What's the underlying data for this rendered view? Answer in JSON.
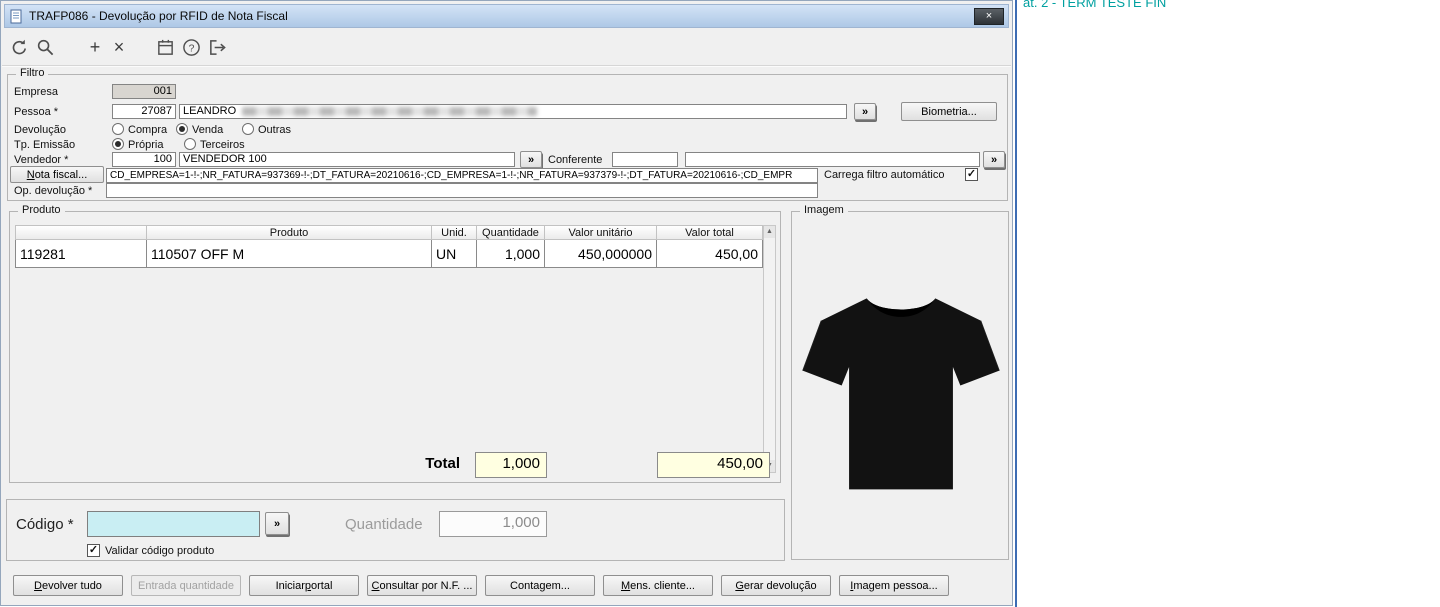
{
  "window": {
    "title": "TRAFP086 - Devolução por RFID de Nota Fiscal",
    "close_glyph": "×"
  },
  "toolbar": {
    "icons": [
      "undo-icon",
      "search-icon",
      "add-icon",
      "delete-icon",
      "calendar-icon",
      "help-icon",
      "exit-icon"
    ],
    "add_glyph": "+",
    "delete_glyph": "×"
  },
  "filtro": {
    "title": "Filtro",
    "empresa": {
      "label": "Empresa",
      "value": "001"
    },
    "pessoa": {
      "label": "Pessoa *",
      "code": "27087",
      "name": "LEANDRO"
    },
    "lookup_symbol": "»",
    "biometria_button": "Biometria...",
    "devolucao": {
      "label": "Devolução",
      "options": [
        "Compra",
        "Venda",
        "Outras"
      ],
      "selected": "Venda"
    },
    "tp_emissao": {
      "label": "Tp. Emissão",
      "options": [
        "Própria",
        "Terceiros"
      ],
      "selected": "Própria"
    },
    "vendedor": {
      "label": "Vendedor *",
      "code": "100",
      "name": "VENDEDOR 100"
    },
    "conferente": {
      "label": "Conferente",
      "code": "",
      "name": ""
    },
    "nota_fiscal": {
      "button": "Nota fiscal...",
      "value": "CD_EMPRESA=1-!-;NR_FATURA=937369-!-;DT_FATURA=20210616-;CD_EMPRESA=1-!-;NR_FATURA=937379-!-;DT_FATURA=20210616-;CD_EMPR"
    },
    "carrega_filtro": {
      "label": "Carrega filtro automático",
      "checked": true,
      "check_glyph": "✓"
    },
    "op_devolucao": {
      "label": "Op. devolução *",
      "value": ""
    }
  },
  "produto": {
    "title": "Produto",
    "columns": [
      "",
      "Produto",
      "Unid.",
      "Quantidade",
      "Valor unitário",
      "Valor total"
    ],
    "rows": [
      {
        "codigo": "119281",
        "produto": "110507 OFF M",
        "unid": "UN",
        "quantidade": "1,000",
        "valor_unitario": "450,000000",
        "valor_total": "450,00"
      }
    ],
    "total": {
      "label": "Total",
      "quantidade": "1,000",
      "valor": "450,00"
    },
    "scroll_up_glyph": "▲",
    "scroll_down_glyph": "▼"
  },
  "imagem": {
    "title": "Imagem",
    "content": "black t-shirt product photo"
  },
  "codigo": {
    "label": "Código *",
    "value": "",
    "validar": {
      "label": "Validar código produto",
      "checked": true,
      "check_glyph": "✓"
    },
    "quantidade": {
      "label": "Quantidade",
      "value": "1,000"
    }
  },
  "actions": [
    {
      "label": "Devolver tudo",
      "enabled": true
    },
    {
      "label": "Entrada quantidade",
      "enabled": false
    },
    {
      "label": "Iniciar portal",
      "enabled": true
    },
    {
      "label": "Consultar por N.F. ...",
      "enabled": true
    },
    {
      "label": "Contagem...",
      "enabled": true
    },
    {
      "label": "Mens. cliente...",
      "enabled": true
    },
    {
      "label": "Gerar devolução",
      "enabled": true
    },
    {
      "label": "Imagem pessoa...",
      "enabled": true
    }
  ],
  "background_window": {
    "title_fragment": "at. 2 - TERM TESTE FIN"
  }
}
